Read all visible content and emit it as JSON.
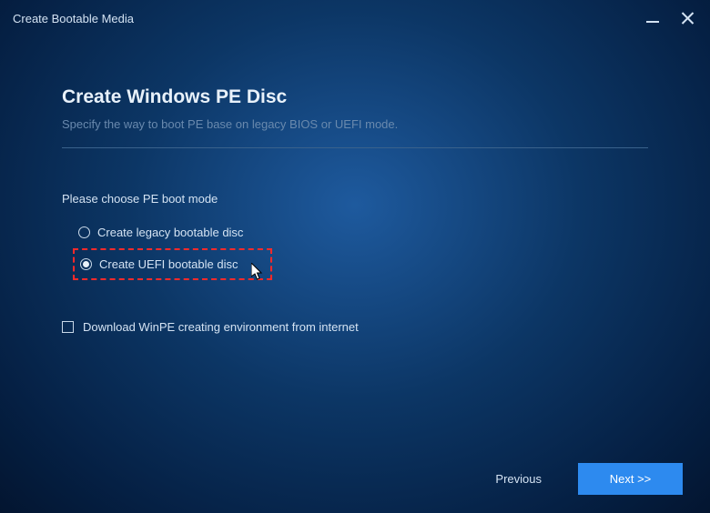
{
  "window": {
    "title": "Create Bootable Media"
  },
  "header": {
    "title": "Create Windows PE Disc",
    "subtitle": "Specify the way to boot PE base on legacy BIOS or UEFI mode."
  },
  "boot_mode": {
    "label": "Please choose PE boot mode",
    "options": {
      "legacy": {
        "label": "Create legacy bootable disc",
        "selected": false
      },
      "uefi": {
        "label": "Create UEFI bootable disc",
        "selected": true
      }
    }
  },
  "download": {
    "label": "Download WinPE creating environment from internet",
    "checked": false
  },
  "footer": {
    "previous_label": "Previous",
    "next_label": "Next >>"
  }
}
